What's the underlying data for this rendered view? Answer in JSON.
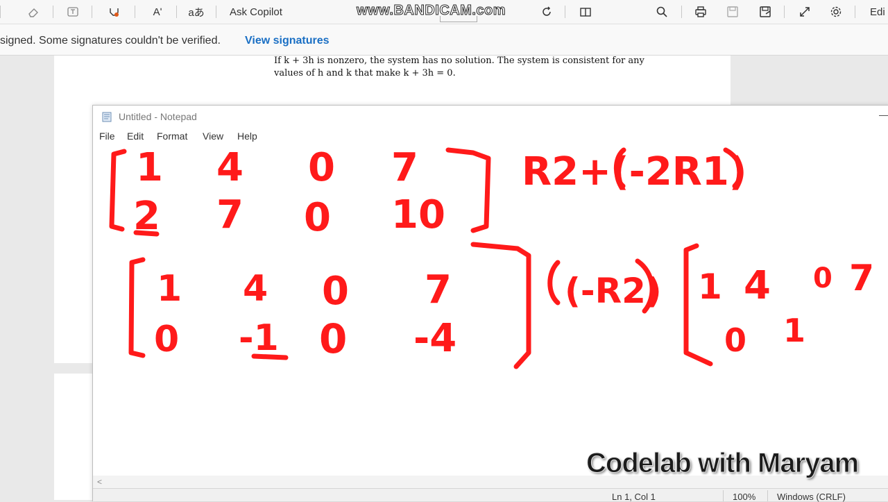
{
  "toolbar": {
    "read_aloud_label": "Aʹ",
    "translate_label": "aあ",
    "ask_copilot": "Ask Copilot",
    "edit_label": "Edi"
  },
  "watermark": "www.BANDICAM.com",
  "signature_bar": {
    "message": "signed. Some signatures couldn't be verified.",
    "link": "View signatures",
    "link_color": "#1a6fc4"
  },
  "pdf": {
    "line1": "If k + 3h is nonzero, the system has no solution. The system is consistent for any",
    "line2": "values of h and k that make k + 3h = 0."
  },
  "notepad": {
    "title": "Untitled - Notepad",
    "menu": [
      "File",
      "Edit",
      "Format",
      "View",
      "Help"
    ],
    "status": {
      "position": "Ln 1, Col 1",
      "zoom": "100%",
      "line_ending": "Windows (CRLF)"
    },
    "scroll_arrow": "<",
    "ink_color": "#ff1a1a",
    "handwriting": {
      "matrix1_row1": [
        "1",
        "4",
        "0",
        "7"
      ],
      "matrix1_row2": [
        "2",
        "7",
        "0",
        "10"
      ],
      "op1": "R2+(-2R1)",
      "matrix2_row1": [
        "1",
        "4",
        "0",
        "7"
      ],
      "matrix2_row2": [
        "0",
        "-1",
        "0",
        "-4"
      ],
      "op2": "(-R2)",
      "matrix3_row1": [
        "1",
        "4",
        "0",
        "7"
      ],
      "matrix3_row2": [
        "0",
        "1"
      ]
    }
  },
  "brand": "Codelab with Maryam"
}
